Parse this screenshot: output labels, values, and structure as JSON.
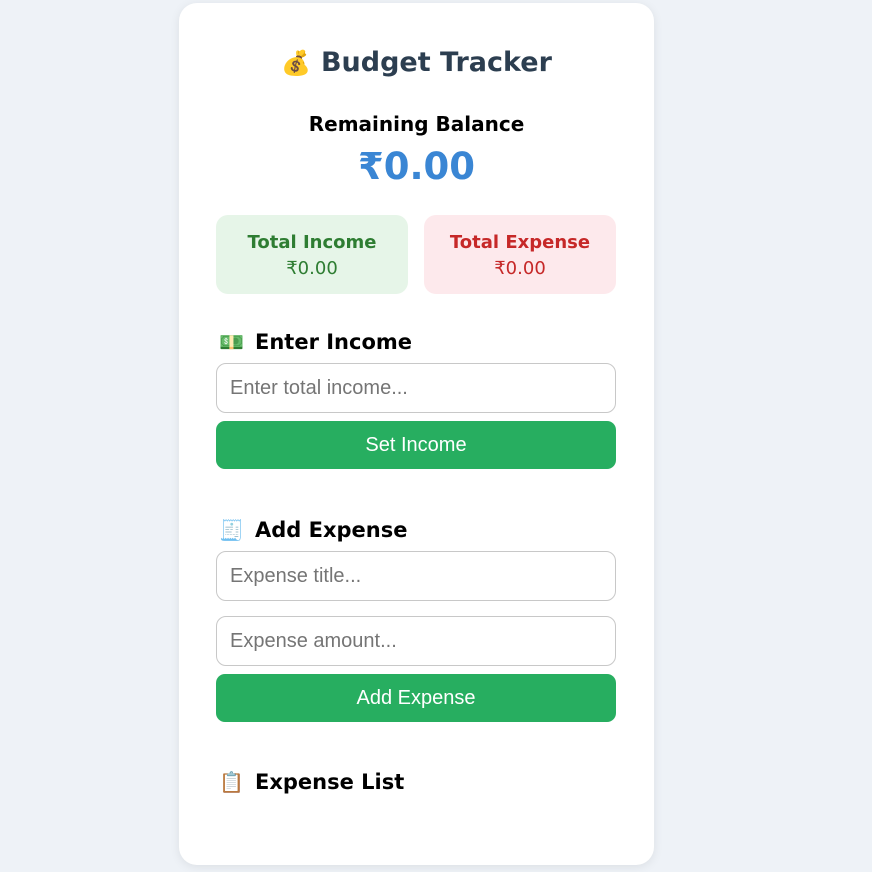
{
  "header": {
    "icon": "money-bag-icon",
    "icon_glyph": "💰",
    "title": "Budget Tracker"
  },
  "balance": {
    "label": "Remaining Balance",
    "value": "₹0.00",
    "color": "#3a86d4"
  },
  "summary": {
    "income": {
      "label": "Total Income",
      "value": "₹0.00",
      "color": "#2e7d32",
      "bg": "#e6f5e8"
    },
    "expense": {
      "label": "Total Expense",
      "value": "₹0.00",
      "color": "#c62828",
      "bg": "#fde9ec"
    }
  },
  "income_section": {
    "icon": "banknote-icon",
    "icon_glyph": "💵",
    "heading": "Enter Income",
    "input_placeholder": "Enter total income...",
    "input_value": "",
    "button_label": "Set Income"
  },
  "expense_section": {
    "icon": "receipt-icon",
    "icon_glyph": "🧾",
    "heading": "Add Expense",
    "title_placeholder": "Expense title...",
    "amount_placeholder": "Expense amount...",
    "button_label": "Add Expense"
  },
  "list_section": {
    "icon": "clipboard-icon",
    "icon_glyph": "📋",
    "heading": "Expense List",
    "items": []
  },
  "colors": {
    "accent_button": "#27ae60",
    "page_background": "#eef2f7"
  }
}
